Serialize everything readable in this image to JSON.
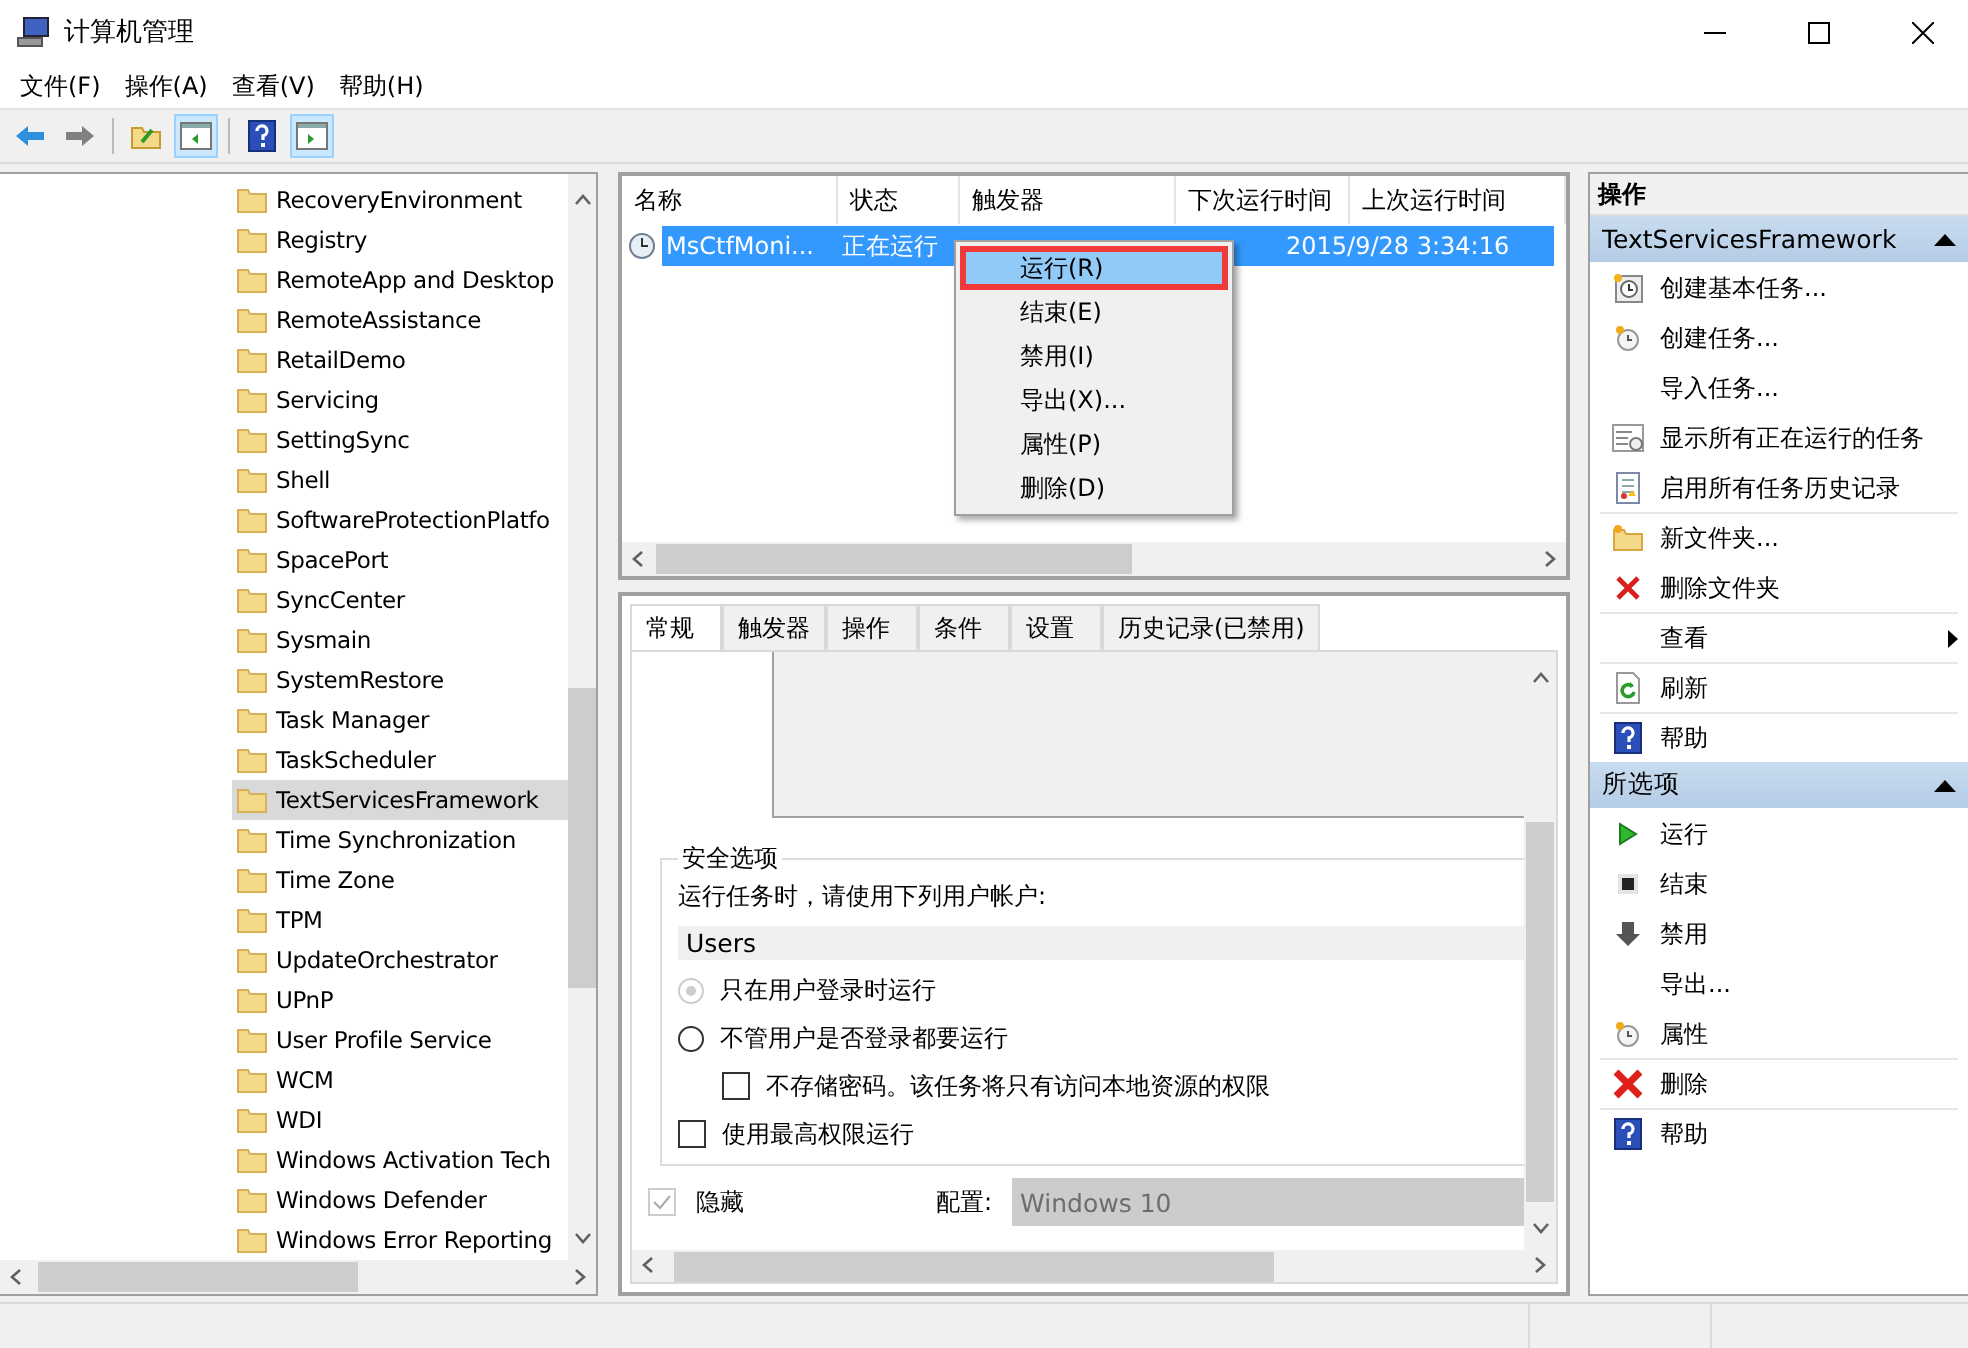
{
  "window": {
    "title": "计算机管理"
  },
  "menu": [
    {
      "label": "文件(F)"
    },
    {
      "label": "操作(A)"
    },
    {
      "label": "查看(V)"
    },
    {
      "label": "帮助(H)"
    }
  ],
  "tree": {
    "items": [
      {
        "label": "RecoveryEnvironment",
        "selected": false
      },
      {
        "label": "Registry",
        "selected": false
      },
      {
        "label": "RemoteApp and Desktop",
        "selected": false
      },
      {
        "label": "RemoteAssistance",
        "selected": false
      },
      {
        "label": "RetailDemo",
        "selected": false
      },
      {
        "label": "Servicing",
        "selected": false
      },
      {
        "label": "SettingSync",
        "selected": false
      },
      {
        "label": "Shell",
        "selected": false
      },
      {
        "label": "SoftwareProtectionPlatfo",
        "selected": false
      },
      {
        "label": "SpacePort",
        "selected": false
      },
      {
        "label": "SyncCenter",
        "selected": false
      },
      {
        "label": "Sysmain",
        "selected": false
      },
      {
        "label": "SystemRestore",
        "selected": false
      },
      {
        "label": "Task Manager",
        "selected": false
      },
      {
        "label": "TaskScheduler",
        "selected": false
      },
      {
        "label": "TextServicesFramework",
        "selected": true
      },
      {
        "label": "Time Synchronization",
        "selected": false
      },
      {
        "label": "Time Zone",
        "selected": false
      },
      {
        "label": "TPM",
        "selected": false
      },
      {
        "label": "UpdateOrchestrator",
        "selected": false
      },
      {
        "label": "UPnP",
        "selected": false
      },
      {
        "label": "User Profile Service",
        "selected": false
      },
      {
        "label": "WCM",
        "selected": false
      },
      {
        "label": "WDI",
        "selected": false
      },
      {
        "label": "Windows Activation Tech",
        "selected": false
      },
      {
        "label": "Windows Defender",
        "selected": false
      },
      {
        "label": "Windows Error Reporting",
        "selected": false
      }
    ]
  },
  "task_table": {
    "columns": [
      "名称",
      "状态",
      "触发器",
      "下次运行时间",
      "上次运行时间"
    ],
    "rows": [
      {
        "name": "MsCtfMoni...",
        "status": "正在运行",
        "last_run": "2015/9/28 3:34:16",
        "selected": true
      }
    ]
  },
  "context_menu": {
    "items": [
      {
        "label": "运行(R)",
        "selected": true,
        "annotated": true
      },
      {
        "label": "结束(E)",
        "selected": false,
        "annotated": false
      },
      {
        "label": "禁用(I)",
        "selected": false,
        "annotated": false
      },
      {
        "label": "导出(X)...",
        "selected": false,
        "annotated": false
      },
      {
        "label": "属性(P)",
        "selected": false,
        "annotated": false
      },
      {
        "label": "删除(D)",
        "selected": false,
        "annotated": false
      }
    ]
  },
  "details": {
    "tabs": [
      {
        "label": "常规",
        "selected": true
      },
      {
        "label": "触发器",
        "selected": false
      },
      {
        "label": "操作",
        "selected": false
      },
      {
        "label": "条件",
        "selected": false
      },
      {
        "label": "设置",
        "selected": false
      },
      {
        "label": "历史记录(已禁用)",
        "selected": false
      }
    ],
    "security": {
      "title": "安全选项",
      "prompt": "运行任务时，请使用下列用户帐户:",
      "account": "Users",
      "options": [
        {
          "kind": "radio",
          "label": "只在用户登录时运行",
          "checked": true,
          "disabled": true
        },
        {
          "kind": "radio",
          "label": "不管用户是否登录都要运行",
          "checked": false,
          "disabled": false,
          "children": [
            {
              "kind": "checkbox",
              "label": "不存储密码。该任务将只有访问本地资源的权限",
              "checked": false,
              "disabled": false
            }
          ]
        },
        {
          "kind": "checkbox",
          "label": "使用最高权限运行",
          "checked": false,
          "disabled": false
        }
      ]
    },
    "hidden": {
      "label": "隐藏",
      "checked": true,
      "disabled": true
    },
    "config": {
      "label": "配置:",
      "value": "Windows 10",
      "disabled": true
    }
  },
  "actions": {
    "title": "操作",
    "sections": [
      {
        "title": "TextServicesFramework",
        "expanded": true,
        "items": [
          {
            "label": "创建基本任务...",
            "kind": "wizard",
            "divider_before": false,
            "submenu": false
          },
          {
            "label": "创建任务...",
            "kind": "clock",
            "divider_before": false,
            "submenu": false
          },
          {
            "label": "导入任务...",
            "kind": "none",
            "divider_before": false,
            "submenu": false
          },
          {
            "label": "显示所有正在运行的任务",
            "kind": "list",
            "divider_before": false,
            "submenu": false
          },
          {
            "label": "启用所有任务历史记录",
            "kind": "log",
            "divider_before": false,
            "submenu": false
          },
          {
            "label": "新文件夹...",
            "kind": "folder",
            "divider_before": true,
            "submenu": false
          },
          {
            "label": "删除文件夹",
            "kind": "delete",
            "divider_before": false,
            "submenu": false
          },
          {
            "label": "查看",
            "kind": "none",
            "divider_before": true,
            "submenu": true
          },
          {
            "label": "刷新",
            "kind": "refresh",
            "divider_before": true,
            "submenu": false
          },
          {
            "label": "帮助",
            "kind": "help",
            "divider_before": true,
            "submenu": false
          }
        ]
      },
      {
        "title": "所选项",
        "expanded": true,
        "items": [
          {
            "label": "运行",
            "kind": "play",
            "divider_before": false,
            "submenu": false
          },
          {
            "label": "结束",
            "kind": "stop",
            "divider_before": false,
            "submenu": false
          },
          {
            "label": "禁用",
            "kind": "down",
            "divider_before": false,
            "submenu": false
          },
          {
            "label": "导出...",
            "kind": "none",
            "divider_before": false,
            "submenu": false
          },
          {
            "label": "属性",
            "kind": "clock",
            "divider_before": false,
            "submenu": false
          },
          {
            "label": "删除",
            "kind": "bigdelete",
            "divider_before": true,
            "submenu": false
          },
          {
            "label": "帮助",
            "kind": "help",
            "divider_before": true,
            "submenu": false
          }
        ]
      }
    ]
  }
}
